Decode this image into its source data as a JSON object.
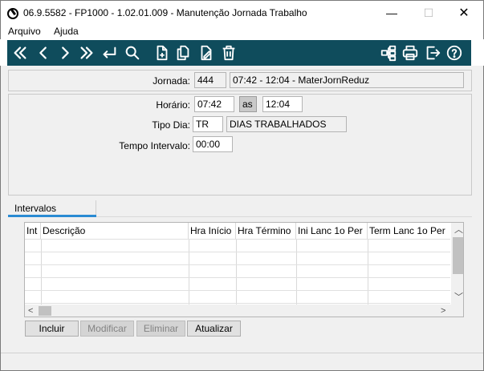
{
  "window": {
    "title": "06.9.5582 - FP1000 - 1.02.01.009 - Manutenção Jornada Trabalho",
    "minimize": "—",
    "maximize": "☐",
    "close": "✕"
  },
  "menu": {
    "items": [
      "Arquivo",
      "Ajuda"
    ]
  },
  "toolbar": {
    "icons": [
      "first-icon",
      "previous-icon",
      "next-icon",
      "last-icon",
      "goto-icon",
      "search-icon",
      "new-icon",
      "copy-icon",
      "edit-icon",
      "delete-icon",
      "structure-icon",
      "print-icon",
      "exit-icon",
      "help-icon"
    ],
    "color": "#0f4c5c"
  },
  "jornada": {
    "label": "Jornada:",
    "code": "444",
    "description": "07:42 - 12:04 - MaterJornReduz"
  },
  "form": {
    "horario_label": "Horário:",
    "horario_start": "07:42",
    "as_label": "as",
    "horario_end": "12:04",
    "tipo_dia_label": "Tipo Dia:",
    "tipo_dia_code": "TR",
    "tipo_dia_desc": "DIAS TRABALHADOS",
    "tempo_intervalo_label": "Tempo Intervalo:",
    "tempo_intervalo": "00:00"
  },
  "tabs": {
    "active": "Intervalos"
  },
  "grid": {
    "columns": [
      "Int",
      "Descrição",
      "Hra Início",
      "Hra Término",
      "Ini Lanc 1o Per",
      "Term Lanc 1o Per"
    ]
  },
  "buttons": {
    "incluir": "Incluir",
    "modificar": "Modificar",
    "eliminar": "Eliminar",
    "atualizar": "Atualizar"
  }
}
